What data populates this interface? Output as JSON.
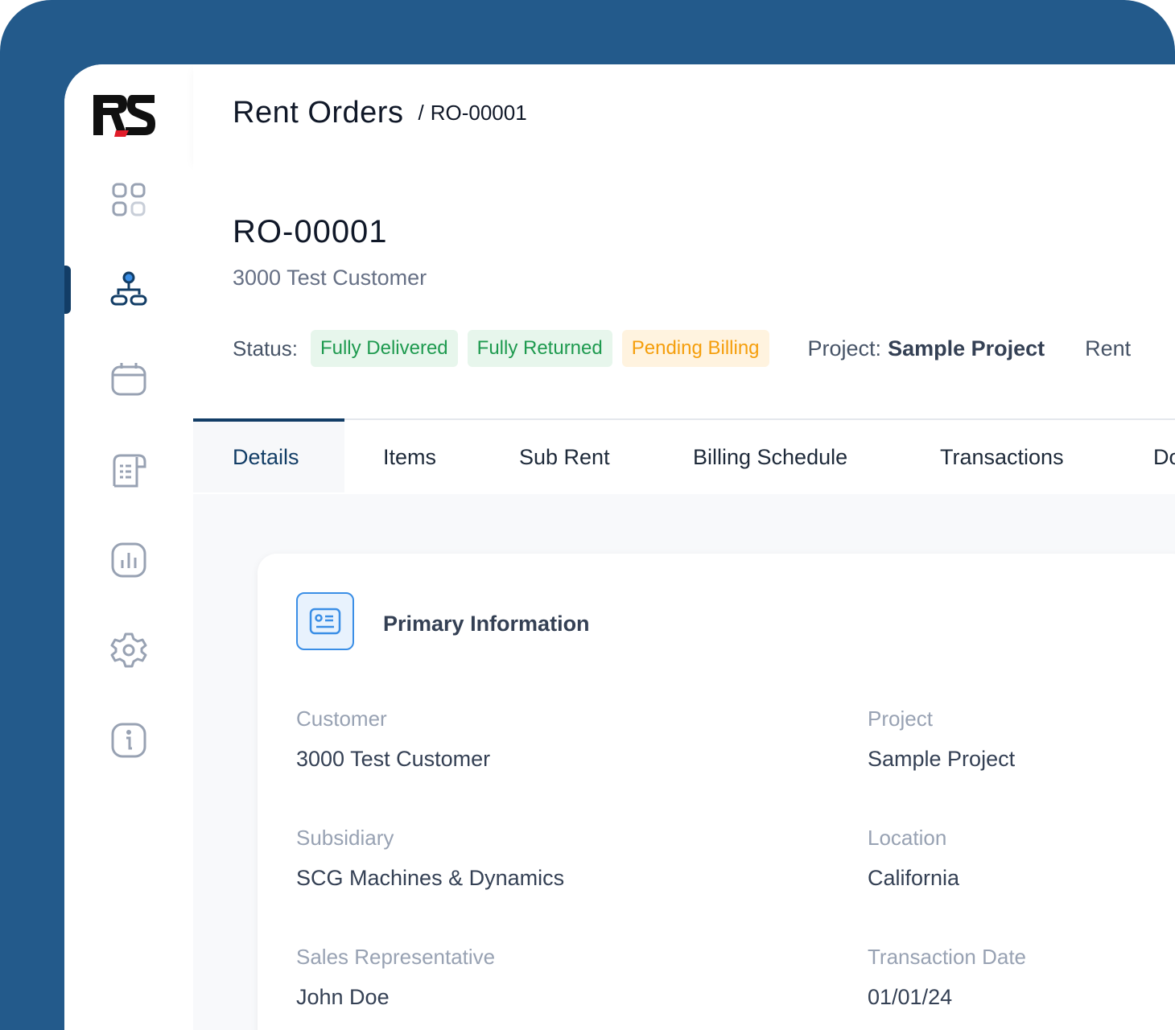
{
  "header": {
    "title": "Rent Orders",
    "breadcrumb_sep": "/",
    "breadcrumb_id": "RO-00001"
  },
  "summary": {
    "order_id": "RO-00001",
    "customer": "3000 Test Customer",
    "status_label": "Status:",
    "badges": [
      "Fully Delivered",
      "Fully Returned",
      "Pending Billing"
    ],
    "project_label": "Project:",
    "project_value": "Sample Project",
    "rent_label": "Rent"
  },
  "tabs": [
    "Details",
    "Items",
    "Sub Rent",
    "Billing Schedule",
    "Transactions",
    "Do"
  ],
  "card": {
    "title": "Primary Information",
    "fields": [
      {
        "label": "Customer",
        "value": "3000 Test Customer"
      },
      {
        "label": "Project",
        "value": "Sample Project"
      },
      {
        "label": "Subsidiary",
        "value": "SCG Machines & Dynamics"
      },
      {
        "label": "Location",
        "value": "California"
      },
      {
        "label": "Sales Representative",
        "value": "John Doe"
      },
      {
        "label": "Transaction Date",
        "value": "01/01/24"
      }
    ]
  },
  "sidebar": {
    "icons": [
      "dashboard-icon",
      "hierarchy-icon",
      "calendar-icon",
      "receipt-icon",
      "chart-icon",
      "settings-icon",
      "info-icon"
    ],
    "active_index": 1
  },
  "colors": {
    "frame": "#235a8b",
    "accent": "#123d66",
    "green": "#1e9a4f",
    "orange": "#f59e0b",
    "blue": "#3a8ee6"
  }
}
